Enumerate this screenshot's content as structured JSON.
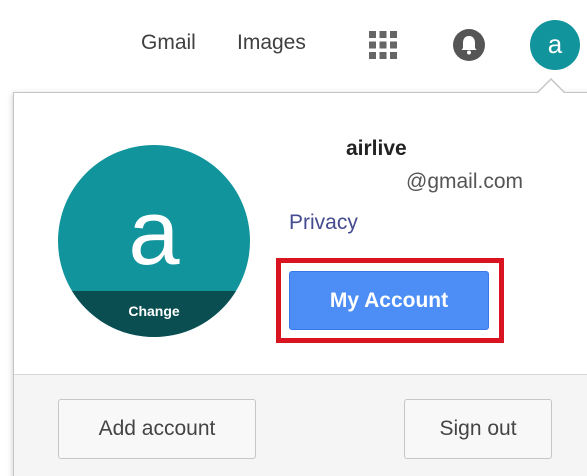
{
  "topbar": {
    "gmail_label": "Gmail",
    "images_label": "Images",
    "apps_icon": "apps-grid-icon",
    "notifications_icon": "bell-icon",
    "avatar_letter": "a"
  },
  "account": {
    "avatar_letter": "a",
    "change_label": "Change",
    "name": "airlive",
    "email": "@gmail.com",
    "privacy_label": "Privacy",
    "my_account_label": "My Account"
  },
  "footer": {
    "add_account_label": "Add account",
    "sign_out_label": "Sign out"
  },
  "colors": {
    "avatar_teal": "#11949c",
    "change_band": "#0b4e52",
    "primary_button": "#4c8df6",
    "highlight_red": "#d9131f",
    "link": "#444b8e"
  }
}
